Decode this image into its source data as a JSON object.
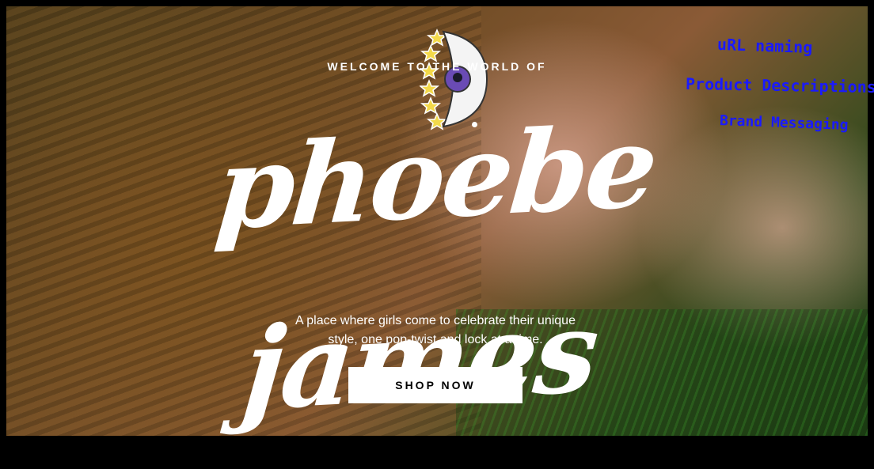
{
  "hero": {
    "eyebrow": "WELCOME TO THE WORLD OF",
    "brand_name": "phoebe james",
    "tagline_line1": "A place where girls come to celebrate their unique",
    "tagline_line2": "style, one pop-twist and lock at a time.",
    "cta_label": "SHOP NOW",
    "background_image": "girl-lying-in-grass-photo",
    "eye_pin_icon": "eye-pin-with-stars-icon"
  },
  "annotations": [
    {
      "text": "uRL naming"
    },
    {
      "text": "Product Descriptions"
    },
    {
      "text": "Brand Messaging"
    }
  ],
  "colors": {
    "annotation_ink": "#1a1aff",
    "cta_background": "#ffffff",
    "cta_text": "#000000"
  }
}
